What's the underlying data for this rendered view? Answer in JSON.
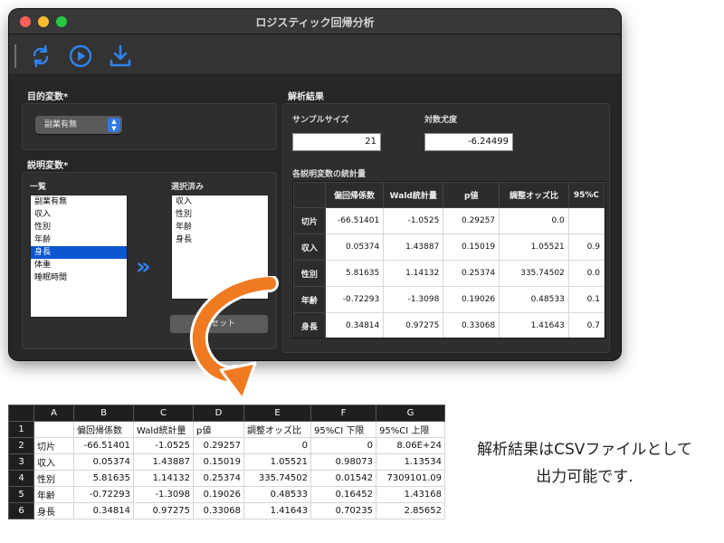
{
  "window": {
    "title": "ロジスティック回帰分析"
  },
  "toolbar": {
    "buttons": [
      "refresh-icon",
      "run-icon",
      "download-icon"
    ]
  },
  "target": {
    "label": "目的変数*",
    "selected": "副業有無"
  },
  "explanatory": {
    "label": "説明変数*",
    "list_label": "一覧",
    "list": [
      "副業有無",
      "収入",
      "性別",
      "年齢",
      "身長",
      "体重",
      "睡眠時間"
    ],
    "selected_index": 4,
    "chosen_label": "選択済み",
    "chosen": [
      "収入",
      "性別",
      "年齢",
      "身長"
    ],
    "reset": "リセット"
  },
  "results": {
    "label": "解析結果",
    "sample_size_label": "サンプルサイズ",
    "sample_size": "21",
    "loglik_label": "対数尤度",
    "loglik": "-6.24499",
    "stats_label": "各説明変数の統計量",
    "columns": [
      "偏回帰係数",
      "Wald統計量",
      "p値",
      "調整オッズ比",
      "95%C"
    ],
    "rows": [
      {
        "name": "切片",
        "values": [
          "-66.51401",
          "-1.0525",
          "0.29257",
          "0.0",
          ""
        ]
      },
      {
        "name": "収入",
        "values": [
          "0.05374",
          "1.43887",
          "0.15019",
          "1.05521",
          "0.9"
        ]
      },
      {
        "name": "性別",
        "values": [
          "5.81635",
          "1.14132",
          "0.25374",
          "335.74502",
          "0.0"
        ]
      },
      {
        "name": "年齢",
        "values": [
          "-0.72293",
          "-1.3098",
          "0.19026",
          "0.48533",
          "0.1"
        ]
      },
      {
        "name": "身長",
        "values": [
          "0.34814",
          "0.97275",
          "0.33068",
          "1.41643",
          "0.7"
        ]
      }
    ]
  },
  "sheet": {
    "col_letters": [
      "A",
      "B",
      "C",
      "D",
      "E",
      "F",
      "G"
    ],
    "row_numbers": [
      "1",
      "2",
      "3",
      "4",
      "5",
      "6"
    ],
    "rows": [
      [
        "",
        "偏回帰係数",
        "Wald統計量",
        "p値",
        "調整オッズ比",
        "95%CI 下限",
        "95%CI 上限"
      ],
      [
        "切片",
        "-66.51401",
        "-1.0525",
        "0.29257",
        "0",
        "0",
        "8.06E+24"
      ],
      [
        "収入",
        "0.05374",
        "1.43887",
        "0.15019",
        "1.05521",
        "0.98073",
        "1.13534"
      ],
      [
        "性別",
        "5.81635",
        "1.14132",
        "0.25374",
        "335.74502",
        "0.01542",
        "7309101.09"
      ],
      [
        "年齢",
        "-0.72293",
        "-1.3098",
        "0.19026",
        "0.48533",
        "0.16452",
        "1.43168"
      ],
      [
        "身長",
        "0.34814",
        "0.97275",
        "0.33068",
        "1.41643",
        "0.70235",
        "2.85652"
      ]
    ]
  },
  "caption": {
    "line1": "解析結果はCSVファイルとして",
    "line2": "出力可能です."
  },
  "colors": {
    "accent": "#2f82f0",
    "arrow": "#f07a22",
    "selection": "#0b57d0"
  }
}
